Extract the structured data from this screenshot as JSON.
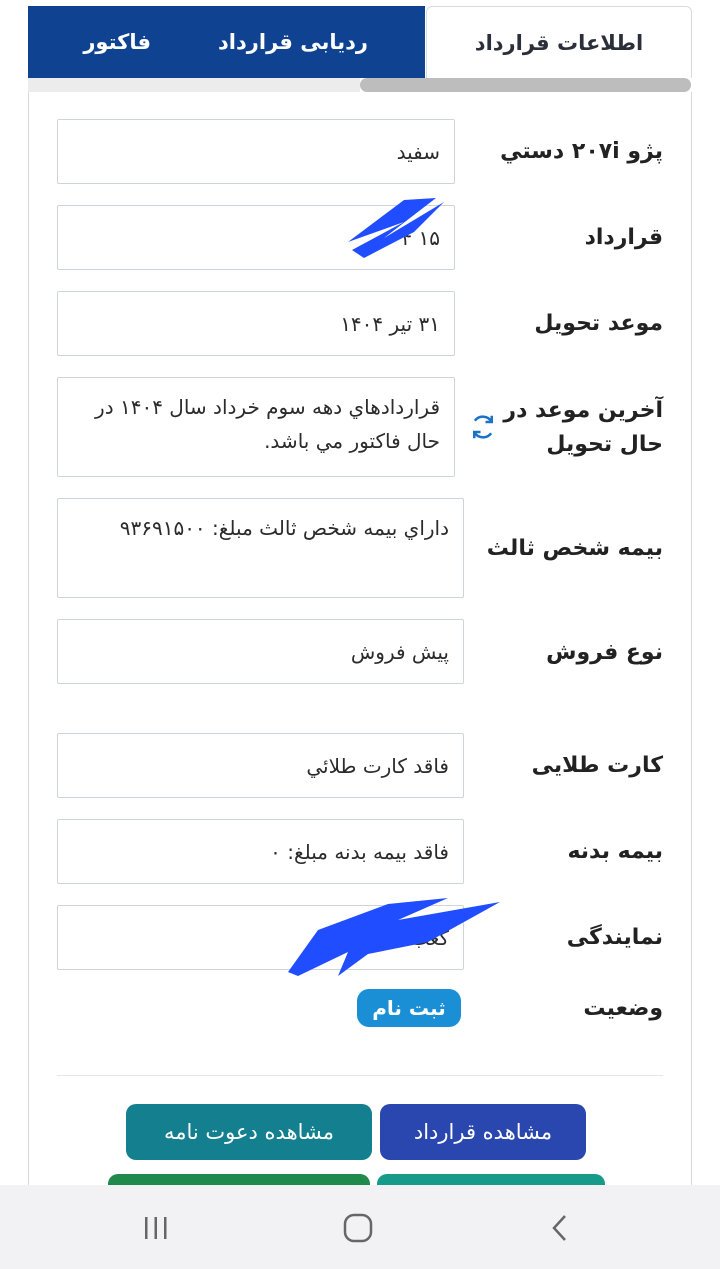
{
  "tabs": {
    "contract_info": "اطلاعات قرارداد",
    "tracking": "ردیابی قرارداد",
    "invoice": "فاکتور"
  },
  "rows": {
    "car": {
      "label": "پژو ۲۰۷i دستي",
      "value": "سفيد"
    },
    "contract": {
      "label": "قرارداد",
      "value": "۱۵        ۰۴"
    },
    "delivery": {
      "label": "موعد تحویل",
      "value": "۳۱ تیر ۱۴۰۴"
    },
    "last_delivery": {
      "label": "آخرین موعد در حال تحویل",
      "value": "قراردادهاي دهه سوم خرداد سال ۱۴۰۴ در حال فاکتور مي باشد."
    },
    "insurance_third": {
      "label": "بیمه شخص ثالث",
      "value": "داراي بيمه شخص ثالث مبلغ: ۹۳۶۹۱۵۰۰"
    },
    "sale_type": {
      "label": "نوع فروش",
      "value": "پيش فروش"
    },
    "gold_card": {
      "label": "کارت طلایی",
      "value": "فاقد کارت طلائي"
    },
    "body_insurance": {
      "label": "بیمه بدنه",
      "value": "فاقد بيمه بدنه مبلغ: ۰"
    },
    "agency": {
      "label": "نمایندگی",
      "value": "کعب-۲۴۶۶"
    },
    "status": {
      "label": "وضعیت",
      "value": "ثبت نام"
    }
  },
  "buttons": {
    "view_contract": "مشاهده قرارداد",
    "view_invitation": "مشاهده دعوت نامه"
  },
  "icons": {
    "refresh": "refresh-icon",
    "nav_recents": "recent-apps-icon",
    "nav_home": "home-icon",
    "nav_back": "back-icon"
  },
  "colors": {
    "tab_blue": "#0f4392",
    "badge_blue": "#1a8fd6",
    "btn_contract": "#2a47b0",
    "btn_invite": "#14808f",
    "redaction": "#1f4dff"
  }
}
